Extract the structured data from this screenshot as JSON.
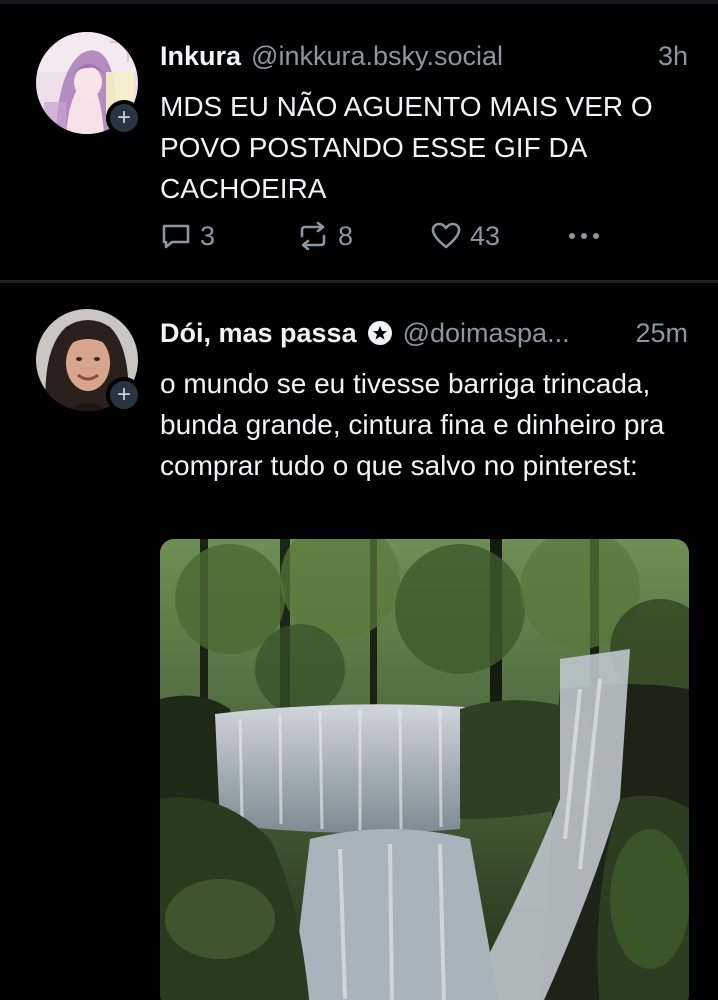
{
  "posts": [
    {
      "author_name": "Inkura",
      "handle": "@inkkura.bsky.social",
      "time": "3h",
      "text": "MDS EU NÃO AGUENTO MAIS VER O POVO POSTANDO ESSE GIF DA CACHOEIRA",
      "replies": "3",
      "reposts": "8",
      "likes": "43",
      "follow_symbol": "+"
    },
    {
      "author_name": "Dói, mas passa",
      "handle": "@doimaspa...",
      "time": "25m",
      "text": "o mundo se eu tivesse barriga trincada, bunda grande, cintura fina e dinheiro pra comprar tudo o que salvo no pinterest:",
      "follow_symbol": "+"
    }
  ],
  "icons": {
    "reply": "speech-bubble-icon",
    "repost": "repost-arrows-icon",
    "like": "heart-outline-icon",
    "more": "ellipsis-icon",
    "verified": "verified-badge-icon"
  },
  "colors": {
    "background": "#000000",
    "text": "#f1f3f5",
    "muted": "#8c96a3",
    "divider": "#1c1f24"
  }
}
